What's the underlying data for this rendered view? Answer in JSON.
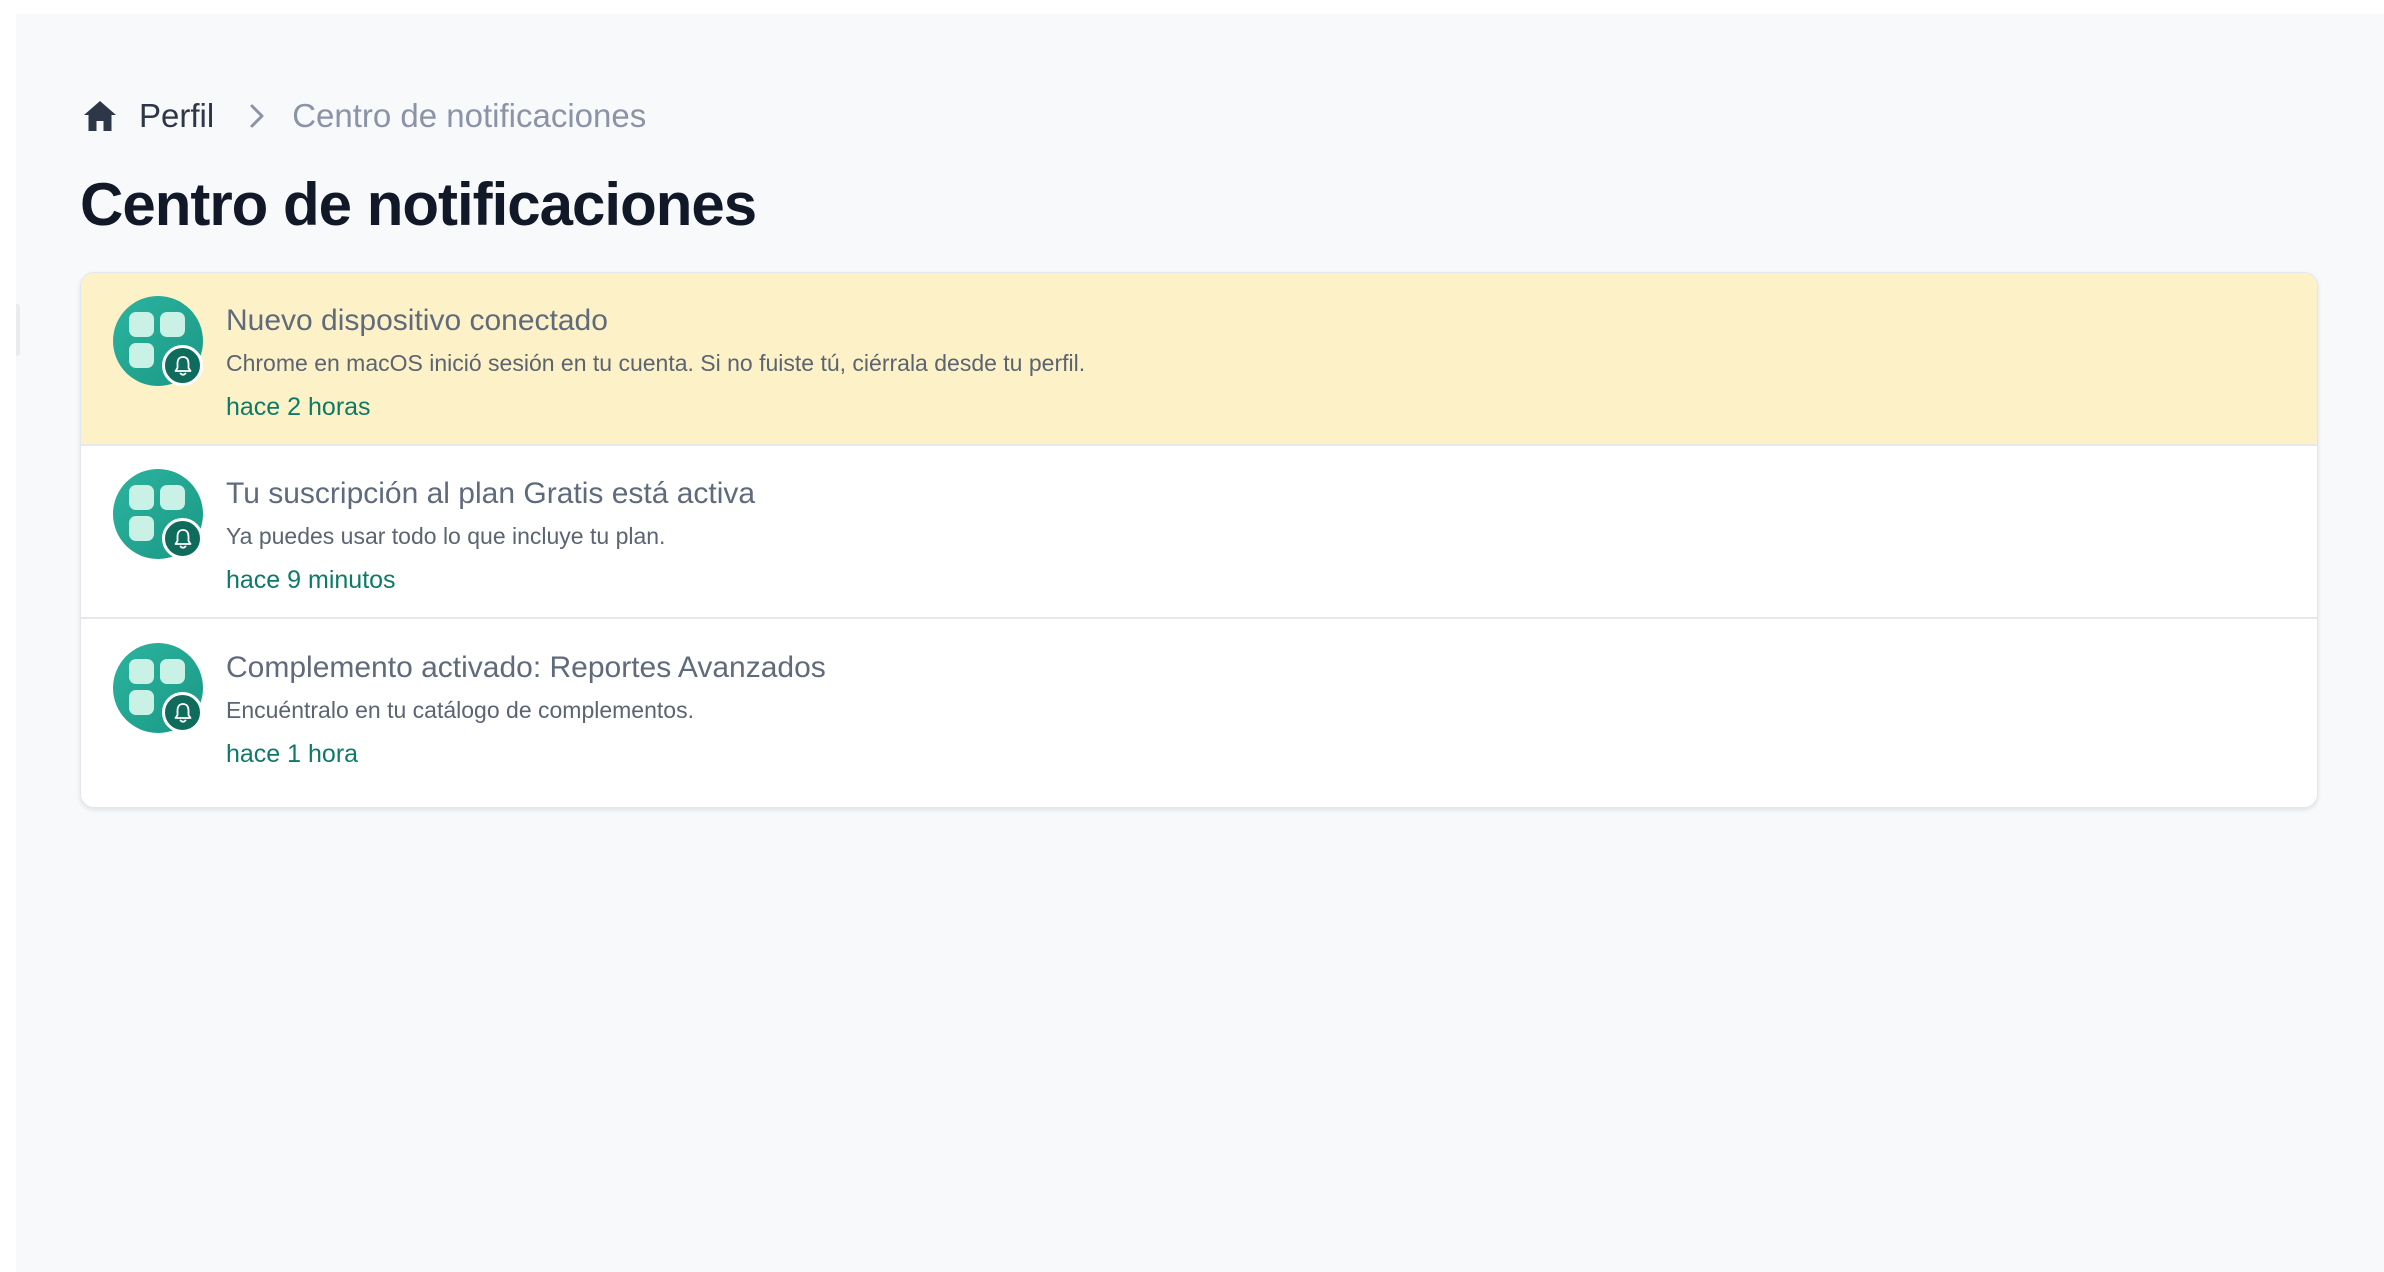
{
  "breadcrumb": {
    "home_icon": "home-icon",
    "parent": "Perfil",
    "separator_icon": "chevron-right-icon",
    "current": "Centro de notificaciones"
  },
  "page_title": "Centro de notificaciones",
  "colors": {
    "background": "#f8f9fb",
    "unread_highlight": "#fdf1c8",
    "accent_teal": "#1a9885",
    "time_text": "#0d7a68"
  },
  "notifications": [
    {
      "title": "Nuevo dispositivo conectado",
      "body": "Chrome en macOS inició sesión en tu cuenta. Si no fuiste tú, ciérrala desde tu perfil.",
      "time": "hace 2 horas",
      "unread": true,
      "icon": "app-grid-icon",
      "badge_icon": "bell-icon"
    },
    {
      "title": "Tu suscripción al plan Gratis está activa",
      "body": "Ya puedes usar todo lo que incluye tu plan.",
      "time": "hace 9 minutos",
      "unread": false,
      "icon": "app-grid-icon",
      "badge_icon": "bell-icon"
    },
    {
      "title": "Complemento activado: Reportes Avanzados",
      "body": "Encuéntralo en tu catálogo de complementos.",
      "time": "hace 1 hora",
      "unread": false,
      "icon": "app-grid-icon",
      "badge_icon": "bell-icon"
    }
  ]
}
